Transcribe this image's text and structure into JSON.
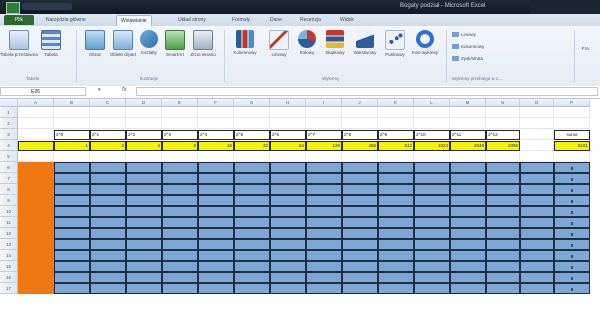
{
  "window": {
    "title": "Bogaty podział - Microsoft Excel"
  },
  "tabs": {
    "file": "Plik",
    "home": "Narzędzia główne",
    "insert": "Wstawianie",
    "page_layout": "Układ strony",
    "formulas": "Formuły",
    "data": "Dane",
    "review": "Recenzja",
    "view": "Widok"
  },
  "ribbon": {
    "groups": {
      "tables": "Tabele",
      "illustrations": "Ilustracje",
      "charts": "Wykresy",
      "sparklines": "Wykresy przebiegu w c..."
    },
    "buttons": {
      "pivot": "Tabela przestawna",
      "table": "Tabela",
      "picture": "Obraz",
      "clipart": "Obiekt clipart",
      "shapes": "Kształty",
      "smartart": "SmartArt",
      "screenshot": "Zrzut ekranu",
      "column": "Kolumnowy",
      "line": "Liniowy",
      "pie": "Kołowy",
      "bar": "Słupkowy",
      "area": "Warstwowy",
      "scatter": "Punktowy",
      "other": "Inne wykresy"
    },
    "small": {
      "spark_line": "Liniowy",
      "spark_column": "Kolumnowy",
      "spark_winloss": "Zysk/strata",
      "slicer": "Fra"
    }
  },
  "formula_bar": {
    "name_box": "E26",
    "fx": "fx",
    "value": ""
  },
  "sheet": {
    "columns": [
      "A",
      "B",
      "C",
      "D",
      "E",
      "F",
      "G",
      "H",
      "I",
      "J",
      "K",
      "L",
      "M",
      "N",
      "O",
      "P"
    ],
    "rows": [
      "1",
      "2",
      "3",
      "4",
      "5",
      "6",
      "7",
      "8",
      "9",
      "10",
      "11",
      "12",
      "13",
      "14",
      "15",
      "16",
      "17"
    ],
    "powers": [
      "2^0",
      "2^1",
      "2^2",
      "2^3",
      "2^4",
      "2^5",
      "2^6",
      "2^7",
      "2^8",
      "2^9",
      "2^10",
      "2^11",
      "2^12"
    ],
    "values": [
      "1",
      "2",
      "4",
      "8",
      "16",
      "32",
      "64",
      "128",
      "256",
      "512",
      "1024",
      "2048",
      "4096"
    ],
    "sum_label": "suma",
    "sum_value": "8191",
    "zero_rows": [
      "0",
      "0",
      "0",
      "0",
      "0",
      "0",
      "0",
      "0",
      "0",
      "0",
      "0",
      "0"
    ]
  },
  "colors": {
    "yellow": "#f6f20a",
    "blue": "#7fa7d4",
    "orange": "#f07812",
    "file_tab": "#2b6a2d"
  }
}
